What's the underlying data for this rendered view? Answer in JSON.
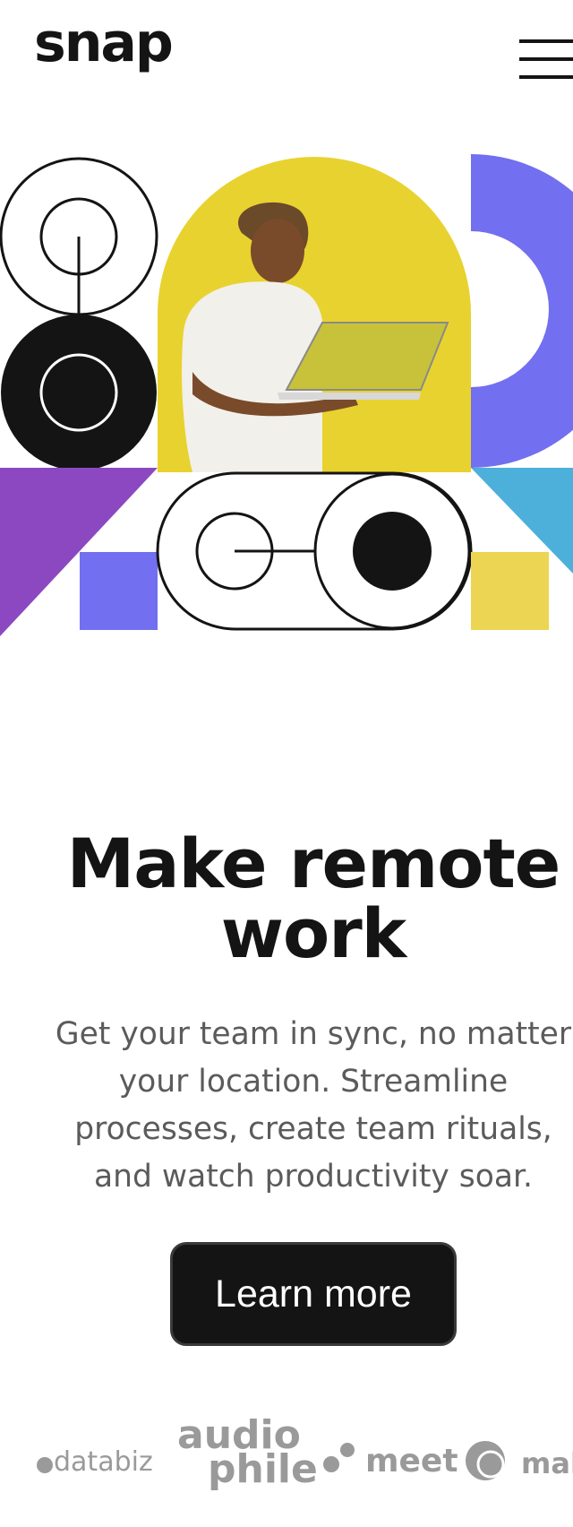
{
  "header": {
    "logo": "snap",
    "menu_icon": "hamburger-menu-icon"
  },
  "hero": {
    "image_alt": "Man with dreadlocks holding a laptop against a yellow background",
    "headline_line1": "Make remote",
    "headline_line2": "work",
    "body_lines": [
      "Get your team in sync, no matter",
      "your location. Streamline",
      "processes, create team rituals,",
      "and watch productivity soar."
    ],
    "cta_label": "Learn more"
  },
  "clients": {
    "logos": [
      "databiz",
      "audio",
      "phile",
      "meet",
      "maker"
    ]
  },
  "colors": {
    "ink": "#141414",
    "yellow": "#e8d22f",
    "violet": "#726ff0",
    "purple": "#8c48c0",
    "sky": "#4cb0da",
    "gold": "#ecd552",
    "muted_text": "#5b5b5b",
    "logo_gray": "#9a9a9a"
  }
}
